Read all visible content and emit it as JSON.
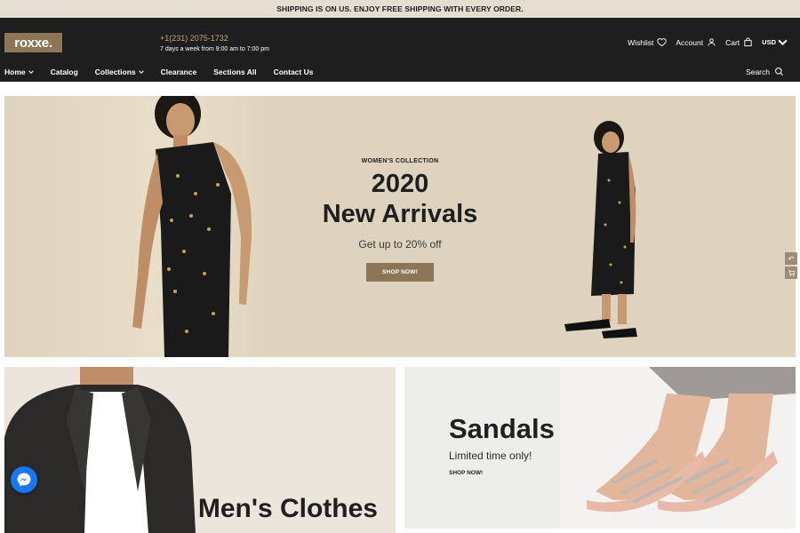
{
  "announcement": "SHIPPING IS ON US. ENJOY FREE SHIPPING WITH EVERY ORDER.",
  "header": {
    "logo": "roxxe.",
    "phone": "+1(231) 2075-1732",
    "hours": "7 days a week from 9:00 am to 7:00 pm",
    "actions": {
      "wishlist": "Wishlist",
      "account": "Account",
      "cart": "Cart",
      "currency": "USD"
    },
    "nav": [
      "Home",
      "Catalog",
      "Collections",
      "Clearance",
      "Sections All",
      "Contact Us"
    ],
    "search": "Search"
  },
  "hero": {
    "kicker": "WOMEN'S COLLECTION",
    "year": "2020",
    "title": "New Arrivals",
    "subtitle": "Get up to 20% off",
    "button": "SHOP NOW!"
  },
  "banners": {
    "men": {
      "title": "Men's Clothes"
    },
    "sandals": {
      "title": "Sandals",
      "subtitle": "Limited time only!",
      "button": "SHOP NOW!"
    }
  },
  "colors": {
    "accent": "#8c7656",
    "header_bg": "#1e1e1e",
    "announce_bg": "#e6ddd1",
    "hero_bg": "#ddd3be",
    "messenger": "#1877f2"
  }
}
